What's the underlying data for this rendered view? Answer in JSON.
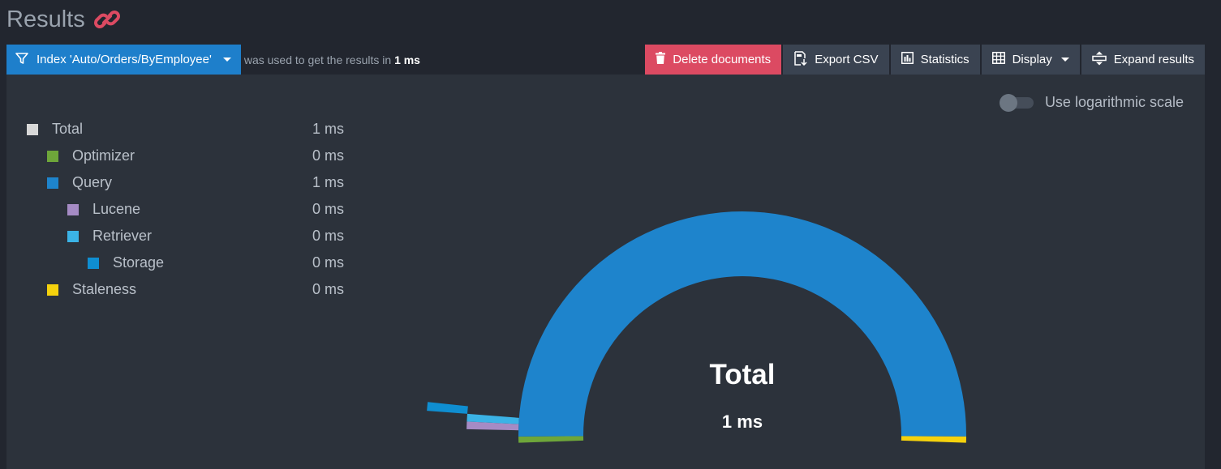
{
  "header": {
    "title": "Results"
  },
  "toolbar": {
    "index_label": "Index 'Auto/Orders/ByEmployee'",
    "used_text": "was used to get the results in",
    "used_time": "1 ms",
    "delete_label": "Delete documents",
    "export_label": "Export CSV",
    "statistics_label": "Statistics",
    "display_label": "Display",
    "expand_label": "Expand results"
  },
  "toggle": {
    "label": "Use logarithmic scale",
    "checked": false
  },
  "legend": [
    {
      "label": "Total",
      "value": "1 ms",
      "color": "#d8d8d8",
      "level": 0
    },
    {
      "label": "Optimizer",
      "value": "0 ms",
      "color": "#6ea63a",
      "level": 1
    },
    {
      "label": "Query",
      "value": "1 ms",
      "color": "#1e84cc",
      "level": 1
    },
    {
      "label": "Lucene",
      "value": "0 ms",
      "color": "#a58bc4",
      "level": 2
    },
    {
      "label": "Retriever",
      "value": "0 ms",
      "color": "#3bb3e6",
      "level": 2
    },
    {
      "label": "Storage",
      "value": "0 ms",
      "color": "#0f8ed1",
      "level": 3
    },
    {
      "label": "Staleness",
      "value": "0 ms",
      "color": "#f5d20d",
      "level": 1
    }
  ],
  "chart_data": {
    "type": "sunburst-gauge",
    "center_label": "Total",
    "center_value": "1 ms",
    "segments": [
      {
        "name": "Optimizer",
        "value": 0,
        "color": "#6ea63a"
      },
      {
        "name": "Query",
        "value": 1,
        "color": "#1e84cc"
      },
      {
        "name": "Staleness",
        "value": 0,
        "color": "#f5d20d"
      }
    ],
    "children": [
      {
        "parent": "Query",
        "name": "Lucene",
        "value": 0,
        "color": "#a58bc4"
      },
      {
        "parent": "Query",
        "name": "Retriever",
        "value": 0,
        "color": "#3bb3e6"
      },
      {
        "parent": "Retriever",
        "name": "Storage",
        "value": 0,
        "color": "#0f8ed1"
      }
    ]
  },
  "colors": {
    "accent": "#1e7fcb",
    "danger": "#dc4a62",
    "link_icon": "#dc4a62"
  },
  "icons": {
    "title": "link-icon",
    "index": "filter-icon",
    "delete": "trash-icon",
    "export": "export-file-icon",
    "statistics": "bar-chart-icon",
    "display": "table-grid-icon",
    "expand": "expand-vertical-icon"
  }
}
